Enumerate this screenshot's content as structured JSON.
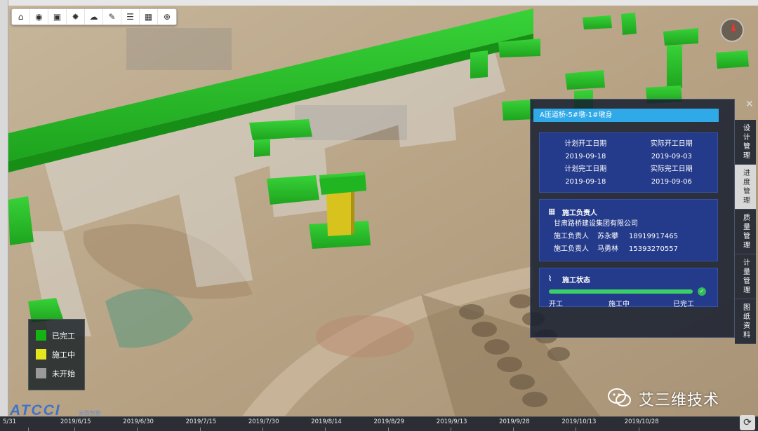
{
  "toolbar": {
    "tools": [
      {
        "name": "home-icon",
        "glyph": "⌂"
      },
      {
        "name": "eye-icon",
        "glyph": "◉"
      },
      {
        "name": "image-icon",
        "glyph": "▣"
      },
      {
        "name": "sun-icon",
        "glyph": "✹"
      },
      {
        "name": "cloud-icon",
        "glyph": "☁"
      },
      {
        "name": "measure-icon",
        "glyph": "✎"
      },
      {
        "name": "list-icon",
        "glyph": "☰"
      },
      {
        "name": "calendar-icon",
        "glyph": "▦"
      },
      {
        "name": "globe-icon",
        "glyph": "⊕"
      }
    ]
  },
  "legend": {
    "items": [
      {
        "label": "已完工",
        "color": "#14b314"
      },
      {
        "label": "施工中",
        "color": "#e3e61c"
      },
      {
        "label": "未开始",
        "color": "#9a9a9a"
      }
    ]
  },
  "logo": {
    "text": "ATCCI",
    "sub": "云数智能"
  },
  "watermark": {
    "text": "艾三维技术"
  },
  "timeline": {
    "ticks": [
      "5/31",
      "2019/6/15",
      "2019/6/30",
      "2019/7/15",
      "2019/7/30",
      "2019/8/14",
      "2019/8/29",
      "2019/9/13",
      "2019/9/28",
      "2019/10/13",
      "2019/10/28"
    ]
  },
  "panel": {
    "title": "A匝道桥-5#墩-1#墩身",
    "dates": {
      "plan_start_label": "计划开工日期",
      "actual_start_label": "实际开工日期",
      "plan_start": "2019-09-18",
      "actual_start": "2019-09-03",
      "plan_end_label": "计划完工日期",
      "actual_end_label": "实际完工日期",
      "plan_end": "2019-09-18",
      "actual_end": "2019-09-06"
    },
    "contractor": {
      "heading": "施工负责人",
      "company": "甘肃路桥建设集团有限公司",
      "people": [
        {
          "role": "施工负责人",
          "name": "苏永攀",
          "phone": "18919917465"
        },
        {
          "role": "施工负责人",
          "name": "马勇林",
          "phone": "15393270557"
        }
      ]
    },
    "status": {
      "heading": "施工状态",
      "progress": 1.0,
      "stages": [
        "开工",
        "施工中",
        "已完工"
      ]
    }
  },
  "side_tabs": [
    {
      "label": "设计管理",
      "active": false
    },
    {
      "label": "进度管理",
      "active": true
    },
    {
      "label": "质量管理",
      "active": false
    },
    {
      "label": "计量管理",
      "active": false
    },
    {
      "label": "图纸资料",
      "active": false
    }
  ],
  "colors": {
    "complete": "#14b314",
    "in_progress": "#d8c21e",
    "not_started": "#9a9a9a",
    "panel_accent": "#2fa9e8"
  }
}
